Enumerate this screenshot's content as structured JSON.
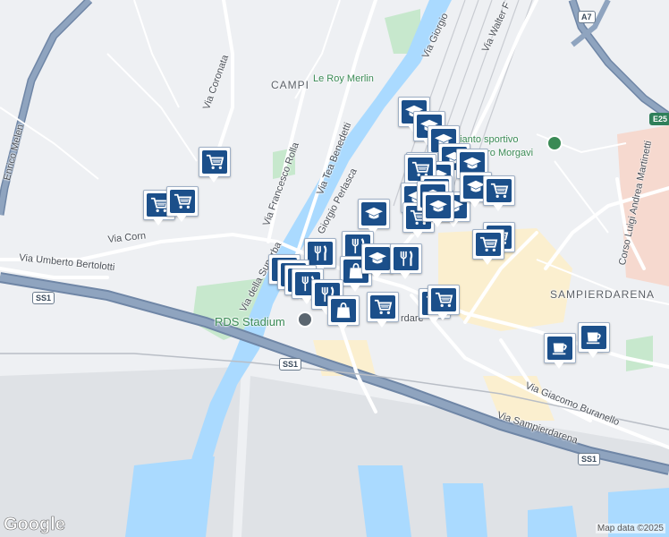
{
  "map": {
    "colors": {
      "water": "#aadaff",
      "park": "#c7e8cd",
      "urban": "#fbefcf",
      "highway": "#8fa4bf",
      "highway_casing": "#6f86a6",
      "road": "#ffffff",
      "land": "#eef0f3"
    },
    "labels": {
      "campi": "CAMPI",
      "sampierdarena": "SAMPIERDARENA",
      "le_roy_merlin": "Le Roy Merlin",
      "impianto_sportivo": "pianto sportivo",
      "uro_morgavi": "uro Morgavi",
      "rds_stadium": "RDS Stadium",
      "via_coronata": "Via Coronata",
      "via_francesco_rolla": "Via Francesco Rolla",
      "via_tea_benedetti": "Via Tea Benedetti",
      "via_giorgio_perlasca": "Giorgio Perlasca",
      "via_giorgio": "Via Giorgio",
      "via_walter": "Via Walter F",
      "via_della_superba": "Via della Superba",
      "via_umberto_bertolotti": "Via Umberto Bertolotti",
      "via_corn": "Via Corn",
      "via_giacomo_buranello": "Via Giacomo Buranello",
      "via_sampierdarena": "Via Sampierdarena",
      "corso_luigi": "Corso Luigi Andrea Martinetti",
      "enrico_melen": "Enrico Melen",
      "rdarena": "rdare",
      "ss1_a": "SS1",
      "ss1_b": "SS1",
      "ss1_c": "SS1",
      "a7": "A7",
      "e25": "E25"
    },
    "markers": [
      {
        "type": "school"
      },
      {
        "type": "school"
      },
      {
        "type": "school"
      },
      {
        "type": "cart"
      },
      {
        "type": "cart"
      },
      {
        "type": "cart"
      },
      {
        "type": "school"
      },
      {
        "type": "school"
      },
      {
        "type": "school"
      },
      {
        "type": "school"
      },
      {
        "type": "cart"
      },
      {
        "type": "school"
      },
      {
        "type": "school"
      },
      {
        "type": "cart"
      },
      {
        "type": "school"
      },
      {
        "type": "cart"
      },
      {
        "type": "school"
      },
      {
        "type": "cart"
      },
      {
        "type": "school"
      },
      {
        "type": "school"
      },
      {
        "type": "cart"
      },
      {
        "type": "cart"
      },
      {
        "type": "restaurant"
      },
      {
        "type": "restaurant"
      },
      {
        "type": "shop"
      },
      {
        "type": "school"
      },
      {
        "type": "restaurant"
      },
      {
        "type": "restaurant"
      },
      {
        "type": "restaurant"
      },
      {
        "type": "restaurant"
      },
      {
        "type": "restaurant"
      },
      {
        "type": "restaurant"
      },
      {
        "type": "shop"
      },
      {
        "type": "cart"
      },
      {
        "type": "cart"
      },
      {
        "type": "cart"
      },
      {
        "type": "coffee"
      },
      {
        "type": "coffee"
      }
    ],
    "logo": "Google",
    "attribution": "Map data ©2025"
  }
}
